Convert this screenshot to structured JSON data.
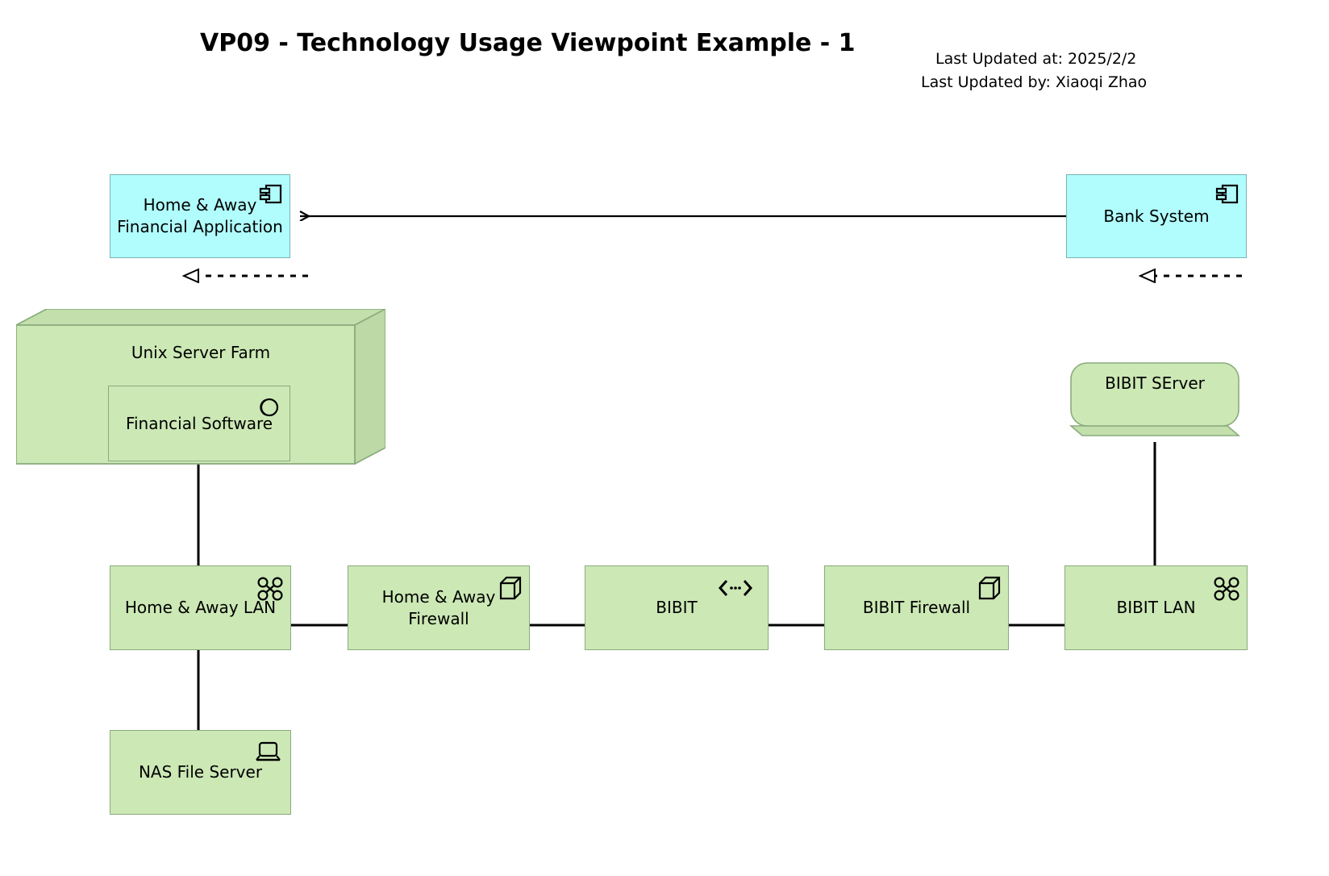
{
  "header": {
    "title": "VP09 - Technology Usage Viewpoint Example - 1",
    "updated_at": "Last Updated at: 2025/2/2",
    "updated_by": "Last Updated by: Xiaoqi Zhao"
  },
  "colors": {
    "application_fill": "#b1fcfc",
    "application_stroke": "#79b5b5",
    "technology_fill": "#cce8b5",
    "technology_stroke": "#8aab7e",
    "line": "#000000",
    "text": "#000000",
    "background": "#ffffff"
  },
  "elements": {
    "home_away_financial_application": {
      "label": "Home & Away Financial Application",
      "type": "application-component",
      "icon": "application-component-icon"
    },
    "bank_system": {
      "label": "Bank System",
      "type": "application-component",
      "icon": "application-component-icon"
    },
    "unix_server_farm": {
      "label": "Unix Server Farm",
      "type": "node",
      "icon": "node-3d-box-icon"
    },
    "financial_software": {
      "label": "Financial Software",
      "type": "system-software",
      "icon": "system-software-icon"
    },
    "bibit_server": {
      "label": "BIBIT SErver",
      "type": "device",
      "icon": "device-icon"
    },
    "home_away_lan": {
      "label": "Home & Away LAN",
      "type": "communication-network",
      "icon": "communication-network-icon"
    },
    "home_away_firewall": {
      "label": "Home & Away Firewall",
      "type": "node",
      "icon": "node-icon"
    },
    "bibit": {
      "label": "BIBIT",
      "type": "path",
      "icon": "path-icon"
    },
    "bibit_firewall": {
      "label": "BIBIT Firewall",
      "type": "node",
      "icon": "node-icon"
    },
    "bibit_lan": {
      "label": "BIBIT LAN",
      "type": "communication-network",
      "icon": "communication-network-icon"
    },
    "nas_file_server": {
      "label": "NAS File Server",
      "type": "device",
      "icon": "device-screen-icon"
    }
  },
  "relationships": [
    {
      "name": "bank-system-to-financial-application",
      "type": "flow",
      "source": "bank_system",
      "target": "home_away_financial_application"
    },
    {
      "name": "financial-software-realizes-application",
      "type": "realization",
      "source": "financial_software",
      "target": "home_away_financial_application"
    },
    {
      "name": "bibit-server-realizes-bank-system",
      "type": "realization",
      "source": "bibit_server",
      "target": "bank_system"
    },
    {
      "name": "financial-software-to-home-away-lan",
      "type": "association",
      "source": "financial_software",
      "target": "home_away_lan"
    },
    {
      "name": "home-away-lan-to-nas-file-server",
      "type": "association",
      "source": "home_away_lan",
      "target": "nas_file_server"
    },
    {
      "name": "home-away-lan-to-home-away-firewall",
      "type": "association",
      "source": "home_away_lan",
      "target": "home_away_firewall"
    },
    {
      "name": "home-away-firewall-to-bibit",
      "type": "association",
      "source": "home_away_firewall",
      "target": "bibit"
    },
    {
      "name": "bibit-to-bibit-firewall",
      "type": "association",
      "source": "bibit",
      "target": "bibit_firewall"
    },
    {
      "name": "bibit-firewall-to-bibit-lan",
      "type": "association",
      "source": "bibit_firewall",
      "target": "bibit_lan"
    },
    {
      "name": "bibit-lan-to-bibit-server",
      "type": "association",
      "source": "bibit_lan",
      "target": "bibit_server"
    }
  ]
}
